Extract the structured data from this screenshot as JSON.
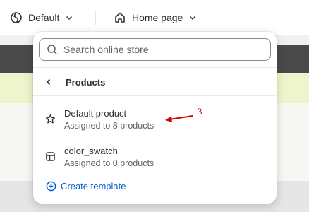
{
  "topbar": {
    "theme_label": "Default",
    "page_label": "Home page"
  },
  "popover": {
    "search_placeholder": "Search online store",
    "back_label": "Products",
    "items": [
      {
        "title": "Default product",
        "subtitle": "Assigned to 8 products",
        "icon": "star-icon"
      },
      {
        "title": "color_swatch",
        "subtitle": "Assigned to 0 products",
        "icon": "template-icon"
      }
    ],
    "create_label": "Create template"
  },
  "annotation": {
    "number": "3",
    "color": "#d40000"
  },
  "colors": {
    "link": "#005bd3",
    "text": "#303030",
    "muted": "#616161"
  }
}
